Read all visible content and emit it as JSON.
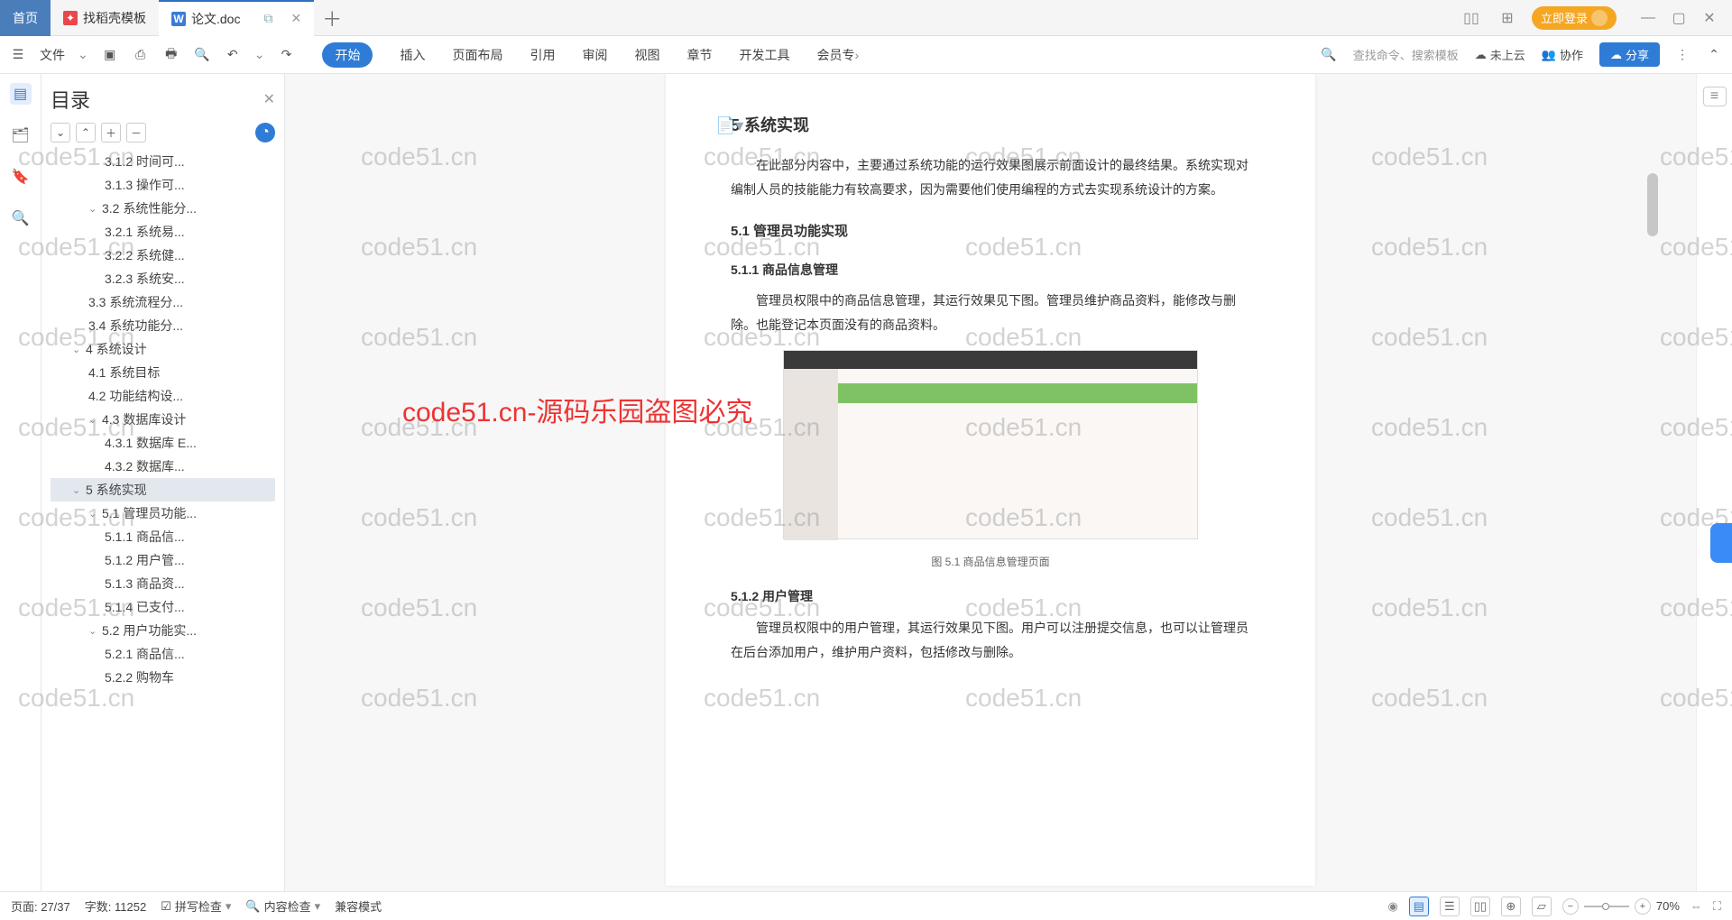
{
  "tabs": {
    "home": "首页",
    "template": "找稻壳模板",
    "doc": "论文.doc"
  },
  "top_right": {
    "login": "立即登录"
  },
  "toolbar": {
    "file": "文件",
    "menus": {
      "start": "开始",
      "insert": "插入",
      "layout": "页面布局",
      "ref": "引用",
      "review": "审阅",
      "view": "视图",
      "chapter": "章节",
      "dev": "开发工具",
      "member": "会员专"
    },
    "search_hint": "查找命令、搜索模板",
    "cloud": "未上云",
    "coop": "协作",
    "share": "分享"
  },
  "outline": {
    "title": "目录",
    "items": [
      {
        "text": "3.1.2 时间可...",
        "indent": 3
      },
      {
        "text": "3.1.3 操作可...",
        "indent": 3
      },
      {
        "text": "3.2 系统性能分...",
        "indent": 2,
        "chev": true
      },
      {
        "text": "3.2.1 系统易...",
        "indent": 3
      },
      {
        "text": "3.2.2 系统健...",
        "indent": 3
      },
      {
        "text": "3.2.3 系统安...",
        "indent": 3
      },
      {
        "text": "3.3 系统流程分...",
        "indent": 2
      },
      {
        "text": "3.4 系统功能分...",
        "indent": 2
      },
      {
        "text": "4  系统设计",
        "indent": 1,
        "chev": true
      },
      {
        "text": "4.1 系统目标",
        "indent": 2
      },
      {
        "text": "4.2 功能结构设...",
        "indent": 2
      },
      {
        "text": "4.3 数据库设计",
        "indent": 2,
        "chev": true
      },
      {
        "text": "4.3.1 数据库 E...",
        "indent": 3
      },
      {
        "text": "4.3.2 数据库...",
        "indent": 3
      },
      {
        "text": "5  系统实现",
        "indent": 1,
        "chev": true,
        "active": true
      },
      {
        "text": "5.1 管理员功能...",
        "indent": 2,
        "chev": true
      },
      {
        "text": "5.1.1  商品信...",
        "indent": 3
      },
      {
        "text": "5.1.2  用户管...",
        "indent": 3
      },
      {
        "text": "5.1.3  商品资...",
        "indent": 3
      },
      {
        "text": "5.1.4  已支付...",
        "indent": 3
      },
      {
        "text": "5.2 用户功能实...",
        "indent": 2,
        "chev": true
      },
      {
        "text": "5.2.1  商品信...",
        "indent": 3
      },
      {
        "text": "5.2.2  购物车",
        "indent": 3
      }
    ]
  },
  "doc": {
    "h5": "5  系统实现",
    "p1": "在此部分内容中，主要通过系统功能的运行效果图展示前面设计的最终结果。系统实现对编制人员的技能能力有较高要求，因为需要他们使用编程的方式去实现系统设计的方案。",
    "h51": "5.1  管理员功能实现",
    "h511": "5.1.1  商品信息管理",
    "p2": "管理员权限中的商品信息管理，其运行效果见下图。管理员维护商品资料，能修改与删除。也能登记本页面没有的商品资料。",
    "figcap": "图 5.1  商品信息管理页面",
    "h512": "5.1.2  用户管理",
    "p3": "管理员权限中的用户管理，其运行效果见下图。用户可以注册提交信息，也可以让管理员在后台添加用户，维护用户资料，包括修改与删除。"
  },
  "overlay": "code51.cn-源码乐园盗图必究",
  "watermark": "code51.cn",
  "status": {
    "page": "页面: 27/37",
    "words": "字数: 11252",
    "spell": "拼写检查",
    "content": "内容检查",
    "compat": "兼容模式",
    "zoom": "70%"
  }
}
